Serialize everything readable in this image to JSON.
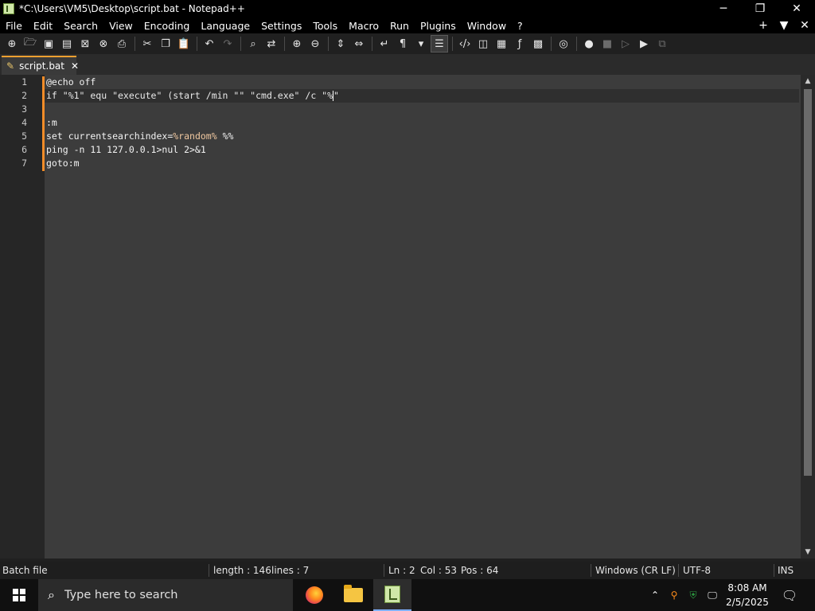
{
  "window": {
    "title": "*C:\\Users\\VM5\\Desktop\\script.bat - Notepad++",
    "controls": {
      "minimize": "─",
      "restore": "❐",
      "close": "✕"
    }
  },
  "menu": {
    "items": [
      "File",
      "Edit",
      "Search",
      "View",
      "Encoding",
      "Language",
      "Settings",
      "Tools",
      "Macro",
      "Run",
      "Plugins",
      "Window",
      "?"
    ],
    "right": {
      "add": "+",
      "dropdown": "▼",
      "close": "✕"
    }
  },
  "toolbar": {
    "icons": [
      "new-file",
      "open-file",
      "save",
      "save-all",
      "close",
      "close-all",
      "print",
      "cut",
      "copy",
      "paste",
      "undo",
      "redo",
      "find",
      "replace",
      "zoom-in",
      "zoom-out",
      "sync-vertical",
      "sync-horizontal",
      "word-wrap",
      "show-all-characters",
      "indent-guide",
      "function-list",
      "folder-as-workspace",
      "map",
      "document-list",
      "function",
      "monitoring",
      "panel",
      "record-macro",
      "stop-macro",
      "play-macro",
      "run-macro",
      "save-macro"
    ]
  },
  "tabs": [
    {
      "label": "script.bat",
      "close": "✕"
    }
  ],
  "editor": {
    "line_numbers": [
      "1",
      "2",
      "3",
      "4",
      "5",
      "6",
      "7"
    ],
    "lines": {
      "l1": "@echo off",
      "l2a": "if \"%1\" equ \"execute\" (start /min \"\" \"cmd.exe\" /c \"%",
      "l2b": "\"",
      "l3": "",
      "l4": ":m",
      "l5a": "set currentsearchindex=",
      "l5b": "%random%",
      "l5c": " %%",
      "l6": "ping -n 11 127.0.0.1>nul 2>&1",
      "l7": "goto:m"
    }
  },
  "status": {
    "language": "Batch file",
    "length": "length : 146",
    "lines": "lines : 7",
    "ln": "Ln : 2",
    "col": "Col : 53",
    "pos": "Pos : 64",
    "eol": "Windows (CR LF)",
    "encoding": "UTF-8",
    "mode": "INS"
  },
  "taskbar": {
    "search_placeholder": "Type here to search",
    "time": "8:08 AM",
    "date": "2/5/2025"
  }
}
